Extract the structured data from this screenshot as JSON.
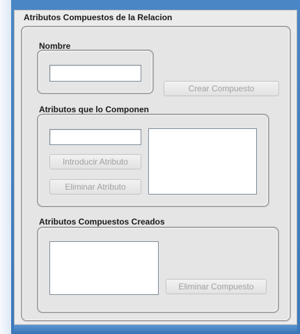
{
  "main": {
    "title": "Atributos Compuestos de la Relacion"
  },
  "nombre": {
    "title": "Nombre",
    "value": "",
    "create_button": "Crear Compuesto"
  },
  "componentes": {
    "title": "Atributos que lo Componen",
    "value": "",
    "add_button": "Introducir Atributo",
    "remove_button": "Eliminar Atributo",
    "items": []
  },
  "creados": {
    "title": "Atributos Compuestos Creados",
    "items": [],
    "remove_button": "Eliminar Compuesto"
  },
  "colors": {
    "window_background": "#ebebeb",
    "frame_blue": "#3c79bb",
    "disabled_text": "#a0a0a0"
  }
}
